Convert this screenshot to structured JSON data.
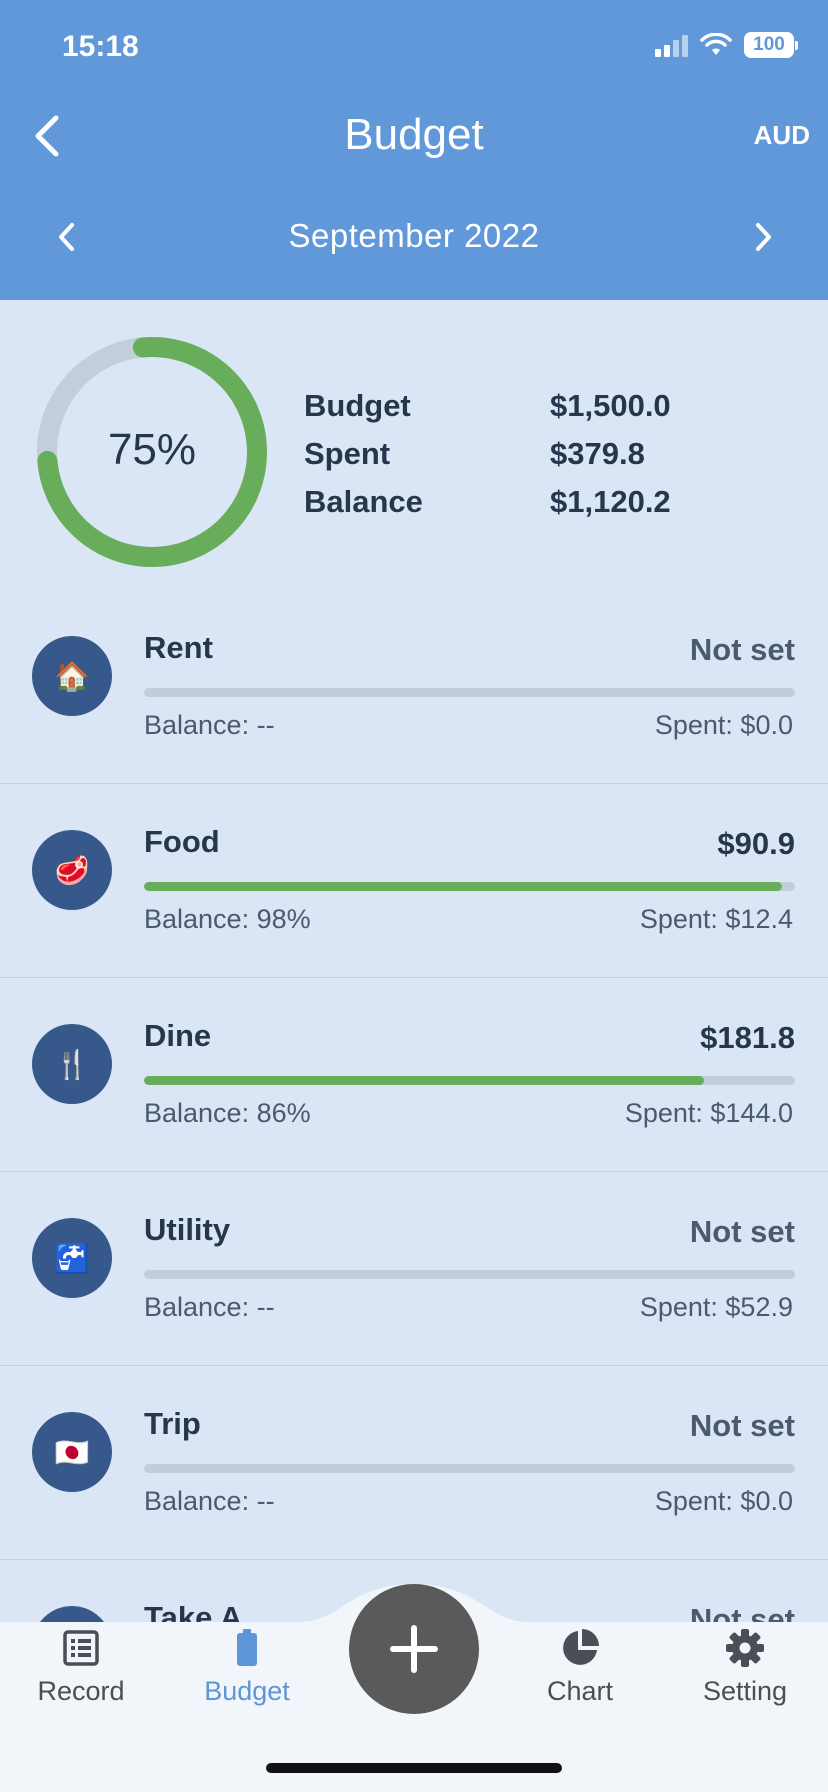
{
  "status": {
    "time": "15:18",
    "battery": "100"
  },
  "header": {
    "title": "Budget",
    "currency": "AUD",
    "month": "September 2022"
  },
  "summary": {
    "percent_label": "75%",
    "percent_value": 0.75,
    "rows": [
      {
        "label": "Budget",
        "value": "$1,500.0"
      },
      {
        "label": "Spent",
        "value": "$379.8"
      },
      {
        "label": "Balance",
        "value": "$1,120.2"
      }
    ]
  },
  "categories": [
    {
      "name": "Rent",
      "icon": "house-icon",
      "emoji": "🏠",
      "amount": "Not set",
      "is_set": false,
      "balance": "Balance: --",
      "spent": "Spent: $0.0",
      "fill": 0
    },
    {
      "name": "Food",
      "icon": "meat-icon",
      "emoji": "🥩",
      "amount": "$90.9",
      "is_set": true,
      "balance": "Balance: 98%",
      "spent": "Spent: $12.4",
      "fill": 0.98
    },
    {
      "name": "Dine",
      "icon": "fork-knife-icon",
      "emoji": "🍴",
      "amount": "$181.8",
      "is_set": true,
      "balance": "Balance: 86%",
      "spent": "Spent: $144.0",
      "fill": 0.86
    },
    {
      "name": "Utility",
      "icon": "faucet-icon",
      "emoji": "🚰",
      "amount": "Not set",
      "is_set": false,
      "balance": "Balance: --",
      "spent": "Spent: $52.9",
      "fill": 0
    },
    {
      "name": "Trip",
      "icon": "japan-flag-icon",
      "emoji": "🇯🇵",
      "amount": "Not set",
      "is_set": false,
      "balance": "Balance: --",
      "spent": "Spent: $0.0",
      "fill": 0
    },
    {
      "name": "Take A",
      "icon": "category-icon",
      "emoji": "",
      "amount": "Not set",
      "is_set": false,
      "balance": "",
      "spent": "",
      "fill": 0
    }
  ],
  "tabs": [
    {
      "label": "Record",
      "icon": "record-list-icon",
      "active": false
    },
    {
      "label": "Budget",
      "icon": "battery-budget-icon",
      "active": true
    },
    {
      "label": "Chart",
      "icon": "pie-chart-icon",
      "active": false
    },
    {
      "label": "Setting",
      "icon": "gear-icon",
      "active": false
    }
  ],
  "colors": {
    "header": "#6098da",
    "background": "#dae6f5",
    "progress": "#68ad5a",
    "track": "#c3cdd9",
    "active_tab": "#5d96d6",
    "fab": "#5a5a5a"
  }
}
